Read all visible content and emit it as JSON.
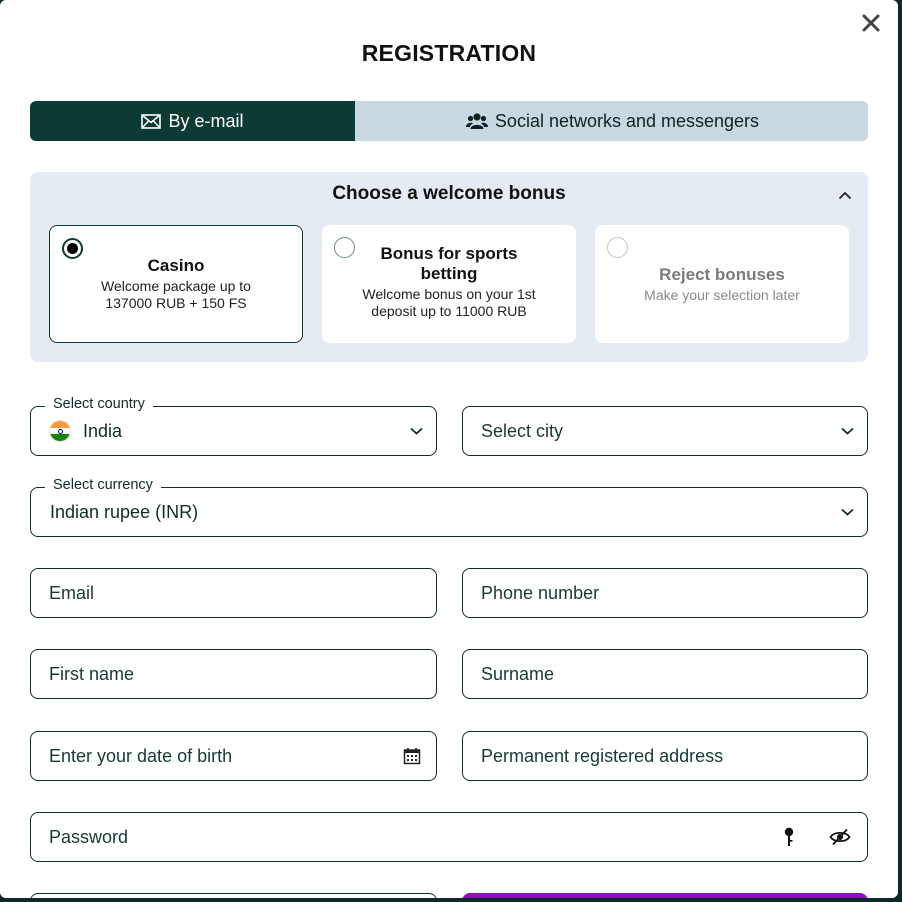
{
  "header": {
    "title": "REGISTRATION",
    "close_icon": "close-icon"
  },
  "tabs": [
    {
      "label": "By e-mail",
      "icon": "envelope-icon",
      "active": true
    },
    {
      "label": "Social networks and messengers",
      "icon": "users-icon",
      "active": false
    }
  ],
  "bonus": {
    "title": "Choose a welcome bonus",
    "collapse_icon": "chevron-up-icon",
    "options": [
      {
        "title": "Casino",
        "desc_line1": "Welcome package up to",
        "desc_line2": "137000 RUB + 150 FS",
        "selected": true
      },
      {
        "title_line1": "Bonus for sports",
        "title_line2": "betting",
        "desc_line1": "Welcome bonus on your 1st",
        "desc_line2": "deposit up to 11000 RUB",
        "selected": false
      },
      {
        "title": "Reject bonuses",
        "desc_line1": "Make your selection later",
        "selected": false
      }
    ]
  },
  "form": {
    "country": {
      "label": "Select country",
      "value": "India",
      "flag": "india-flag-icon"
    },
    "city": {
      "placeholder": "Select city"
    },
    "currency": {
      "label": "Select currency",
      "value": "Indian rupee (INR)"
    },
    "email": {
      "placeholder": "Email"
    },
    "phone": {
      "placeholder": "Phone number"
    },
    "first_name": {
      "placeholder": "First name"
    },
    "surname": {
      "placeholder": "Surname"
    },
    "dob": {
      "placeholder": "Enter your date of birth",
      "icon": "calendar-icon"
    },
    "address": {
      "placeholder": "Permanent registered address"
    },
    "password": {
      "placeholder": "Password",
      "icons": [
        "key-icon",
        "eye-off-icon"
      ]
    }
  },
  "colors": {
    "accent_dark": "#0c3b33",
    "tab_inactive": "#c9d7e0",
    "bonus_bg": "#e4ebf2",
    "submit": "#8f14b8"
  }
}
